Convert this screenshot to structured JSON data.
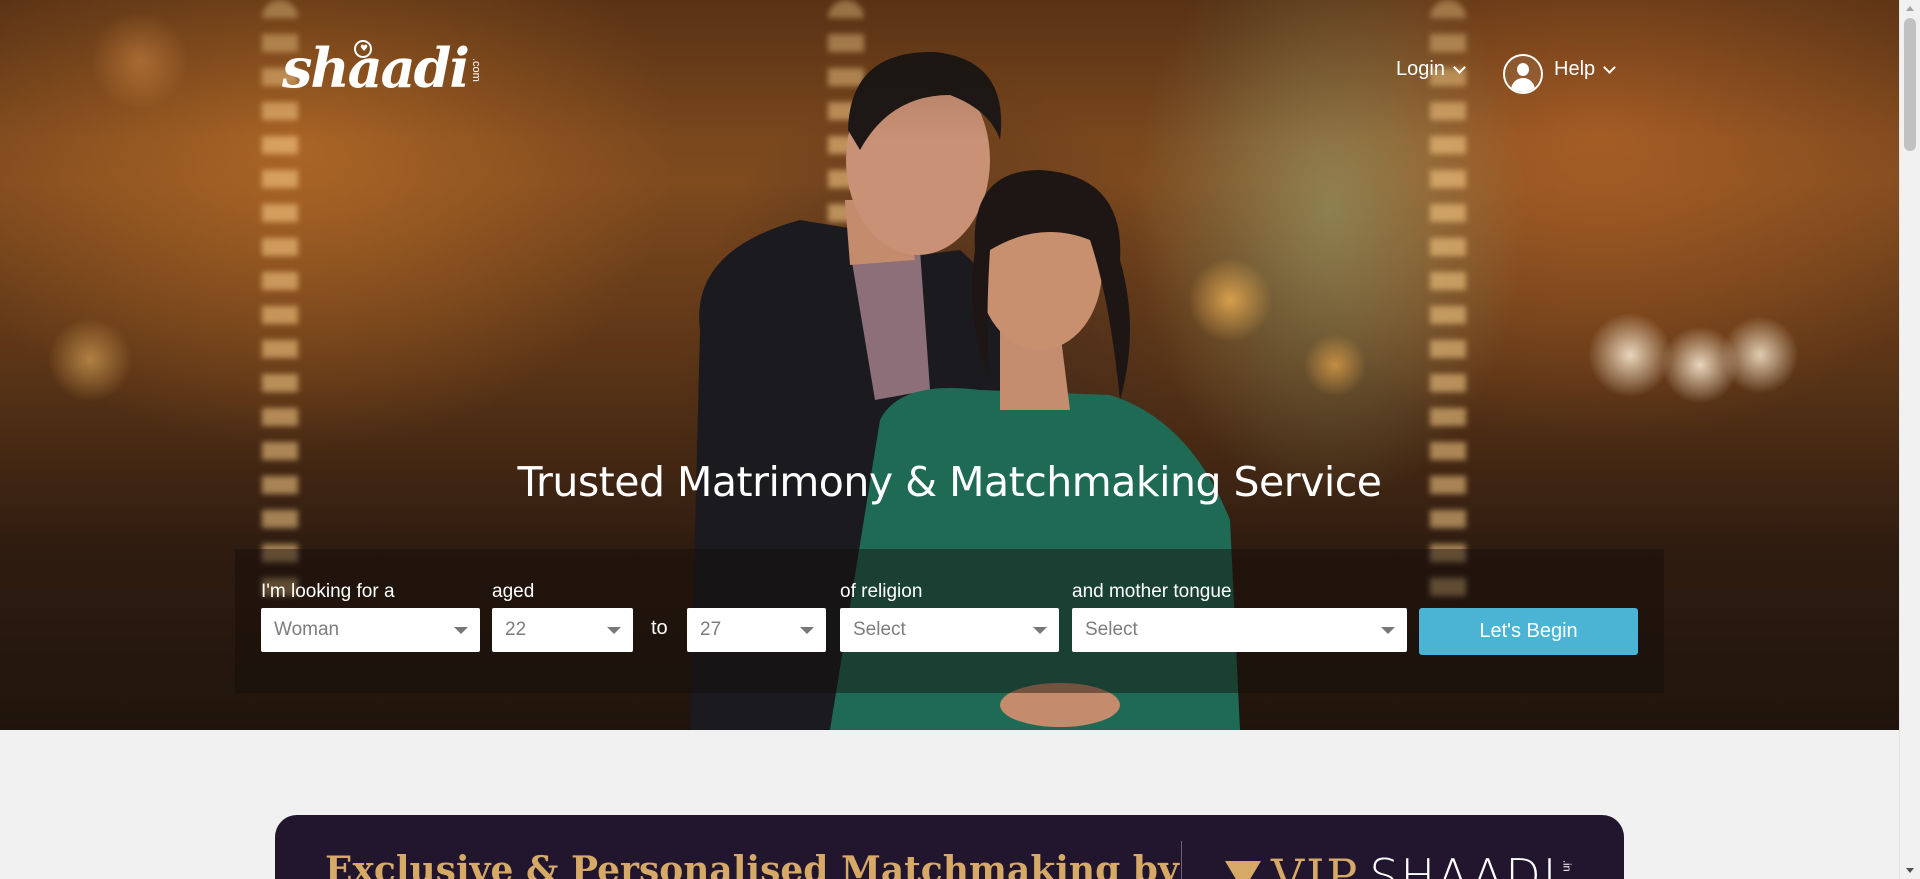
{
  "header": {
    "logo_text": "shaadi",
    "logo_suffix": ".com",
    "login_label": "Login",
    "help_label": "Help"
  },
  "hero": {
    "headline": "Trusted Matrimony & Matchmaking Service"
  },
  "search": {
    "looking_for_label": "I'm looking for a",
    "looking_for_value": "Woman",
    "aged_label": "aged",
    "age_from_value": "22",
    "to_label": "to",
    "age_to_value": "27",
    "religion_label": "of religion",
    "religion_value": "Select",
    "mother_tongue_label": "and mother tongue",
    "mother_tongue_value": "Select",
    "submit_label": "Let's Begin"
  },
  "vip_banner": {
    "text": "Exclusive & Personalised Matchmaking by",
    "logo_vip": "VIP",
    "logo_shaadi": "SHAADI",
    "logo_suffix": ".in"
  },
  "colors": {
    "cta": "#4bb4d4",
    "vip_background": "#22162e",
    "vip_gold": "#d6a967"
  },
  "icons": [
    "chevron-down-icon",
    "user-avatar-icon",
    "caret-down-icon",
    "vip-diamond-icon"
  ]
}
